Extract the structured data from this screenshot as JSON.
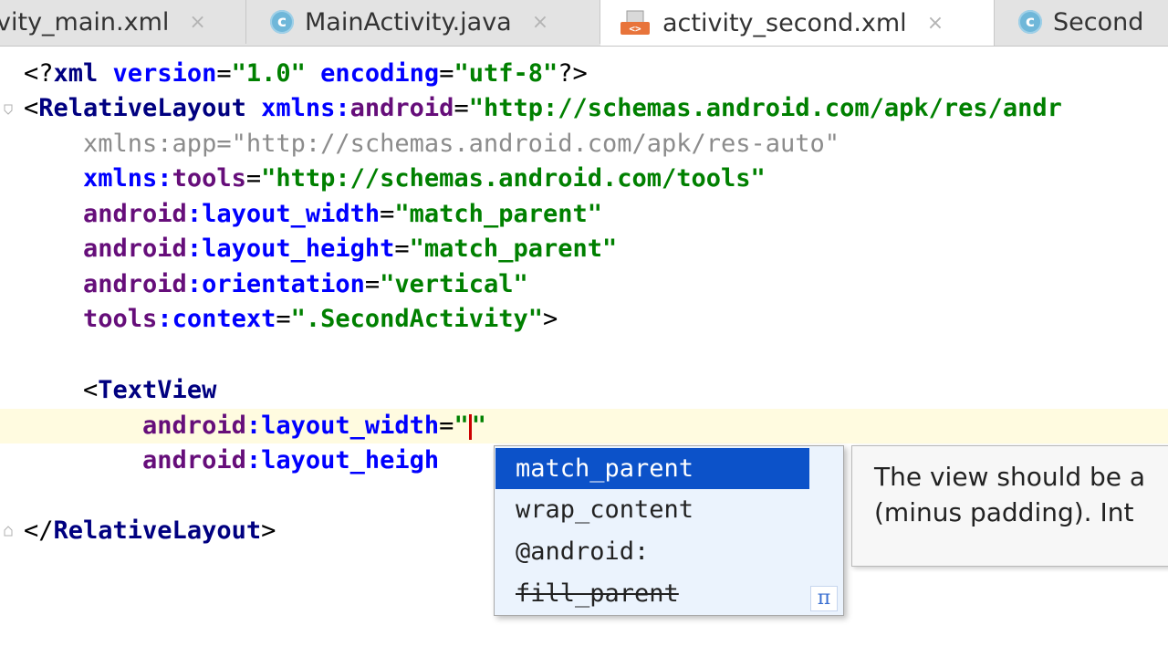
{
  "tabs": [
    {
      "label": "vity_main.xml",
      "icon": "xml-file-icon",
      "active": false
    },
    {
      "label": "MainActivity.java",
      "icon": "java-class-icon",
      "active": false
    },
    {
      "label": "activity_second.xml",
      "icon": "xml-file-icon",
      "active": true
    },
    {
      "label": "Second",
      "icon": "java-class-icon",
      "active": false
    }
  ],
  "tab_close_glyph": "×",
  "class_icon_letter": "c",
  "code": {
    "l1": {
      "a": "<?",
      "b": "xml",
      "c": " version",
      "d": "=",
      "e": "\"1.0\"",
      "f": " encoding",
      "g": "=",
      "h": "\"utf-8\"",
      "i": "?>"
    },
    "l2": {
      "a": "<",
      "b": "RelativeLayout",
      "c": " xmlns:",
      "d": "android",
      "e": "=",
      "f": "\"http://schemas.android.com/apk/res/andr"
    },
    "l3": "    xmlns:app=\"http://schemas.android.com/apk/res-auto\"",
    "l4": {
      "a": "    xmlns:",
      "b": "tools",
      "c": "=",
      "d": "\"http://schemas.android.com/tools\""
    },
    "l5": {
      "a": "    android",
      "b": ":layout_width",
      "c": "=",
      "d": "\"match_parent\""
    },
    "l6": {
      "a": "    android",
      "b": ":layout_height",
      "c": "=",
      "d": "\"match_parent\""
    },
    "l7": {
      "a": "    android",
      "b": ":orientation",
      "c": "=",
      "d": "\"vertical\""
    },
    "l8": {
      "a": "    tools",
      "b": ":context",
      "c": "=",
      "d": "\".SecondActivity\"",
      "e": ">"
    },
    "l10": {
      "a": "    <",
      "b": "TextView"
    },
    "l11": {
      "a": "        android",
      "b": ":layout_width",
      "c": "=",
      "d": "\"",
      "e": "\""
    },
    "l12": {
      "a": "        android",
      "b": ":layout_heigh"
    },
    "l14": {
      "a": "</",
      "b": "RelativeLayout",
      "c": ">"
    }
  },
  "completion": {
    "items": [
      "match_parent",
      "wrap_content",
      "@android:",
      "fill_parent"
    ],
    "selected_index": 0,
    "deprecated_index": 3,
    "pi_glyph": "π"
  },
  "doc_popup": {
    "line1": "The view should be a",
    "line2": "(minus padding). Int"
  },
  "colors": {
    "tag": "#000080",
    "attribute": "#0000ff",
    "namespace": "#660e7a",
    "string": "#008000",
    "selection": "#0c52c9",
    "caret": "#cc0000"
  }
}
